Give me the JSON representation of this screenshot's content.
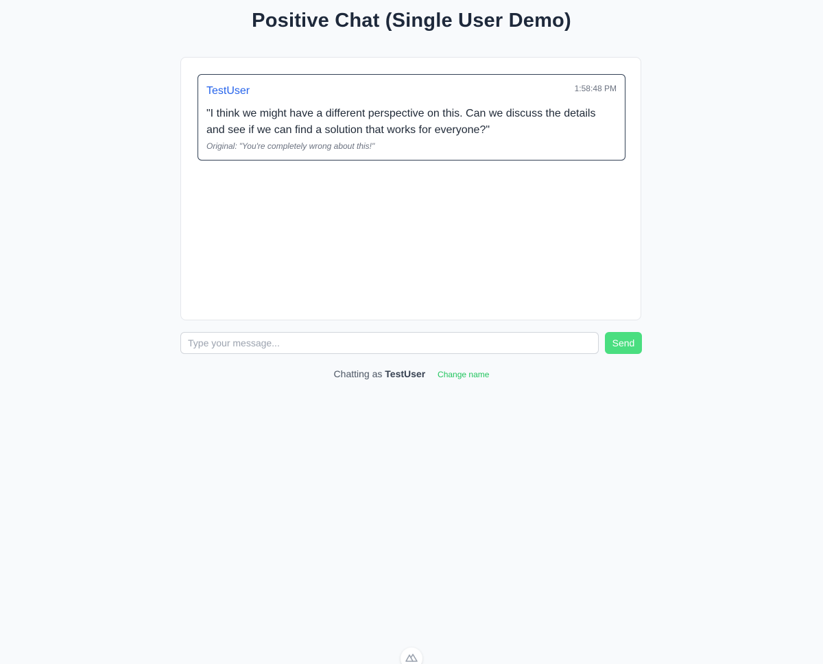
{
  "header": {
    "title": "Positive Chat (Single User Demo)"
  },
  "messages": [
    {
      "author": "TestUser",
      "time": "1:58:48 PM",
      "text": "\"I think we might have a different perspective on this. Can we discuss the details and see if we can find a solution that works for everyone?\"",
      "original_label": "Original:",
      "original_text": "\"You're completely wrong about this!\""
    }
  ],
  "composer": {
    "placeholder": "Type your message...",
    "value": "",
    "send_label": "Send"
  },
  "status": {
    "prefix": "Chatting as",
    "username": "TestUser",
    "change_name_label": "Change name"
  },
  "footer": {
    "badge_icon": "nuxt-logo-icon"
  },
  "colors": {
    "accent_green": "#4ade80",
    "link_green": "#22c55e",
    "author_blue": "#2563eb",
    "background": "#f8fafc"
  }
}
